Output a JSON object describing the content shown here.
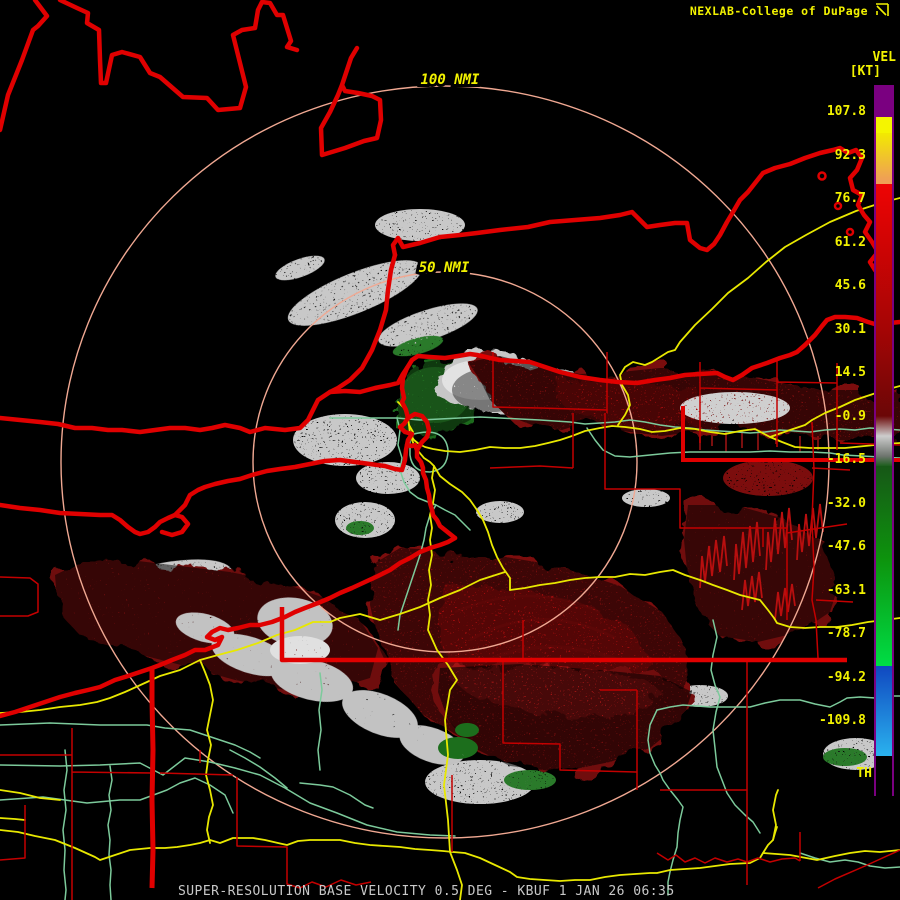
{
  "header": {
    "title": "NEXLAB-College of DuPage",
    "title_color": "#f2f200",
    "logo_icon": "cod-logo-icon"
  },
  "colorbar": {
    "product_label": "VEL",
    "units_label": "[KT]",
    "threshold_label": "TH",
    "label_color": "#f2f200",
    "border_color": "#7a0080",
    "ticks": [
      "107.8",
      "92.3",
      "76.7",
      "61.2",
      "45.6",
      "30.1",
      "14.5",
      "-0.9",
      "-16.5",
      "-32.0",
      "-47.6",
      "-63.1",
      "-78.7",
      "-94.2",
      "-109.8"
    ],
    "segments": [
      {
        "from": 0,
        "to": 30,
        "color": "#7a0080"
      },
      {
        "from": 30,
        "to": 46,
        "color": "#f5f500"
      },
      {
        "from": 46,
        "to": 92,
        "color": "#f2ea00",
        "color_to": "#efa055"
      },
      {
        "from": 92,
        "to": 97,
        "color": "#efa055"
      },
      {
        "from": 97,
        "to": 245,
        "color": "#ee0404",
        "color_to": "#a30505"
      },
      {
        "from": 245,
        "to": 329,
        "color": "#a30505",
        "color_to": "#6b0707"
      },
      {
        "from": 329,
        "to": 349,
        "color": "#6b0707",
        "color_to": "#cdcdcd"
      },
      {
        "from": 349,
        "to": 369,
        "color": "#cdcdcd",
        "color_to": "#6f756f"
      },
      {
        "from": 369,
        "to": 379,
        "color": "#6f756f",
        "color_to": "#1d5e1d"
      },
      {
        "from": 379,
        "to": 472,
        "color": "#175717",
        "color_to": "#0d930d"
      },
      {
        "from": 472,
        "to": 579,
        "color": "#0d930d",
        "color_to": "#00dd45"
      },
      {
        "from": 579,
        "to": 669,
        "color": "#1048c0",
        "color_to": "#2ab2ee"
      },
      {
        "from": 669,
        "to": 709,
        "color": "#000000"
      }
    ]
  },
  "rings": {
    "outer_label": "100 NMI",
    "inner_label": "50 NMI",
    "ring_color": "#f0a892",
    "label_color": "#f2f200"
  },
  "status_bar": {
    "text": "SUPER-RESOLUTION BASE VELOCITY 0.5 DEG - KBUF 1 JAN 26 06:35",
    "color": "#c8c8c8"
  },
  "map_colors": {
    "background": "#000000",
    "shoreline": "#e00000",
    "county_border": "#c40000",
    "highway": "#e8e800",
    "secondary_road": "#7cca9b",
    "echo_outbound": "#7c1010",
    "echo_inbound": "#1d6b1d",
    "echo_near_zero": "#c6c6c6"
  }
}
